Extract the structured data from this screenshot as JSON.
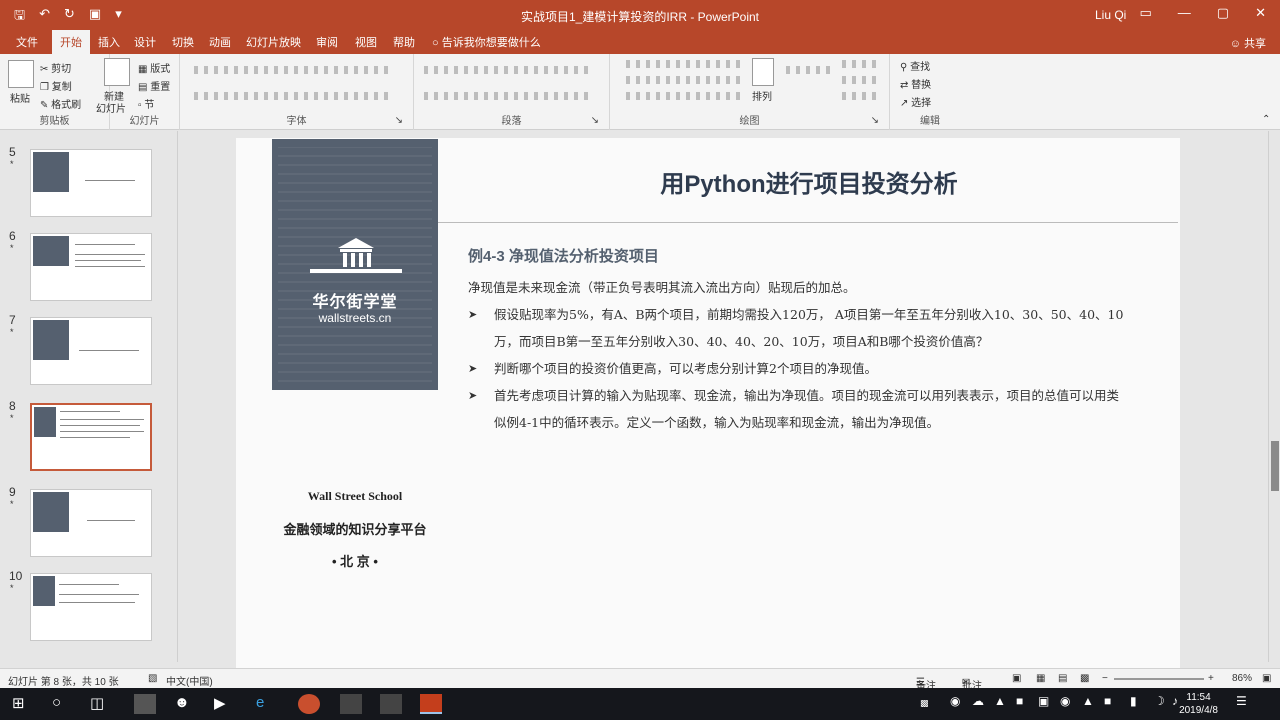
{
  "window": {
    "title": "实战项目1_建模计算投资的IRR - PowerPoint",
    "user": "Liu Qi",
    "controls": [
      "▭",
      "—",
      "▢",
      "✕"
    ]
  },
  "tabs": [
    {
      "label": "文件"
    },
    {
      "label": "开始"
    },
    {
      "label": "插入"
    },
    {
      "label": "设计"
    },
    {
      "label": "切换"
    },
    {
      "label": "动画"
    },
    {
      "label": "幻灯片放映"
    },
    {
      "label": "审阅"
    },
    {
      "label": "视图"
    },
    {
      "label": "帮助"
    },
    {
      "label": "告诉我你想要做什么"
    }
  ],
  "share_label": "共享",
  "ribbon": {
    "clipboard": {
      "paste": "粘贴",
      "cut": "剪切",
      "copy": "复制",
      "format_painter": "格式刷",
      "label": "剪贴板"
    },
    "slides": {
      "new_slide": "新建",
      "new_slide2": "幻灯片",
      "layout": "版式",
      "reset": "重置",
      "section": "节",
      "label": "幻灯片"
    },
    "font": {
      "label": "字体"
    },
    "paragraph": {
      "label": "段落"
    },
    "drawing": {
      "arrange": "排列",
      "label": "绘图"
    },
    "editing": {
      "find": "查找",
      "replace": "替换",
      "select": "选择",
      "label": "编辑"
    }
  },
  "thumbnails": [
    {
      "num": "5",
      "star": "*"
    },
    {
      "num": "6",
      "star": "*"
    },
    {
      "num": "7",
      "star": "*"
    },
    {
      "num": "8",
      "star": "*"
    },
    {
      "num": "9",
      "star": "*"
    },
    {
      "num": "10",
      "star": "*"
    }
  ],
  "slide": {
    "brand_name": "华尔街学堂",
    "brand_url": "wallstreets.cn",
    "school": "Wall Street School",
    "platform": "金融领域的知识分享平台",
    "city": "• 北 京 •",
    "heading": "用Python进行项目投资分析",
    "subheading": "例4-3 净现值法分析投资项目",
    "intro": "净现值是未来现金流（带正负号表明其流入流出方向）贴现后的加总。",
    "bullets": [
      "假设贴现率为5%，有A、B两个项目，前期均需投入120万， A项目第一年至五年分别收入10、30、50、40、10万，而项目B第一至五年分别收入30、40、40、20、10万，项目A和B哪个投资价值高？",
      "判断哪个项目的投资价值更高，可以考虑分别计算2个项目的净现值。",
      "首先考虑项目计算的输入为贴现率、现金流，输出为净现值。项目的现金流可以用列表表示，项目的总值可以用类似例4-1中的循环表示。定义一个函数，输入为贴现率和现金流，输出为净现值。"
    ]
  },
  "status": {
    "slide_info": "幻灯片 第 8 张，共 10 张",
    "language": "中文(中国)",
    "notes": "备注",
    "comments": "批注",
    "zoom": "86%"
  },
  "taskbar": {
    "time": "11:54",
    "date": "2019/4/8"
  },
  "colors": {
    "accent": "#b7472a",
    "slide_dark": "#55606f",
    "heading": "#2e3b4e",
    "selected_thumb": "#c55a3a"
  }
}
